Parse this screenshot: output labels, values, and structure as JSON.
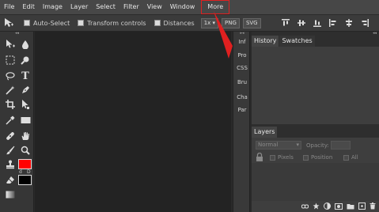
{
  "menu": {
    "items": [
      "File",
      "Edit",
      "Image",
      "Layer",
      "Select",
      "Filter",
      "View",
      "Window",
      "More"
    ],
    "highlighted": "More",
    "highlight_color": "#e02020"
  },
  "options": {
    "auto_select": "Auto-Select",
    "transform_controls": "Transform controls",
    "distances": "Distances",
    "zoom": "1x",
    "png": "PNG",
    "svg": "SVG"
  },
  "mini_panels": [
    "Inf",
    "Pro",
    "CSS",
    "Bru",
    "Cha",
    "Par"
  ],
  "history_panel": {
    "tabs": [
      "History",
      "Swatches"
    ]
  },
  "layers_panel": {
    "tab": "Layers",
    "blend_mode": "Normal",
    "opacity_label": "Opacity:",
    "pixels_label": "Pixels",
    "position_label": "Position",
    "all_label": "All"
  },
  "colors": {
    "foreground": "#ff0000",
    "background": "#000000"
  },
  "swatch_labels": {
    "default": "d",
    "swap": "D"
  }
}
